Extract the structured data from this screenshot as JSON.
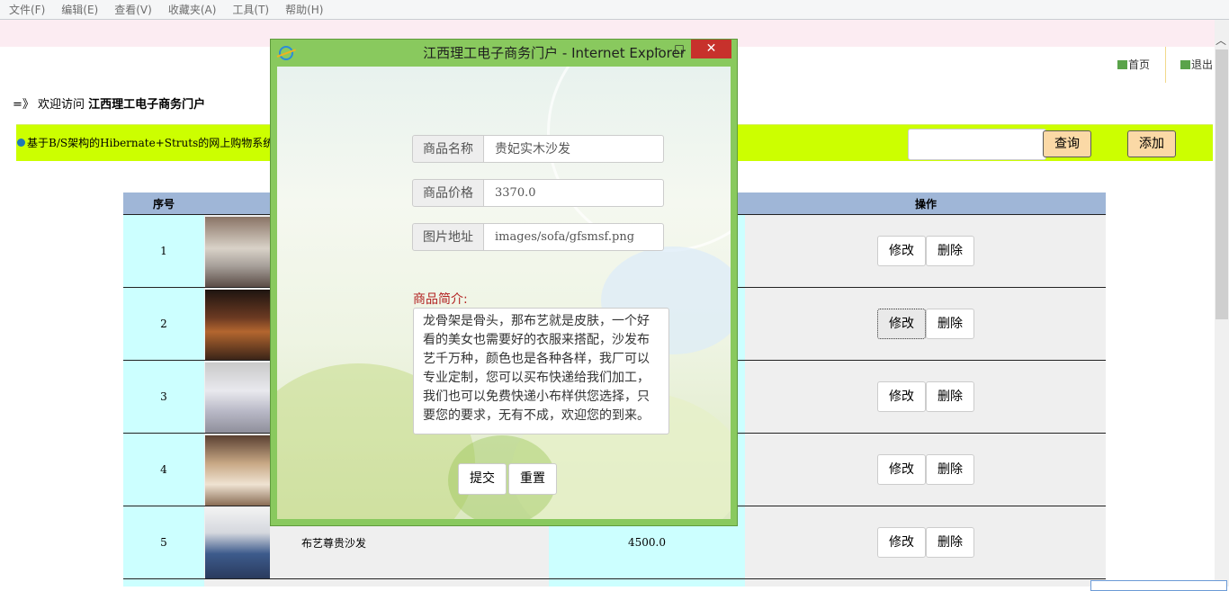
{
  "menu": [
    "文件(F)",
    "编辑(E)",
    "查看(V)",
    "收藏夹(A)",
    "工具(T)",
    "帮助(H)"
  ],
  "toplinks": {
    "home": "首页",
    "logout": "退出"
  },
  "welcome": {
    "prefix": "=》 欢迎访问 ",
    "site": "江西理工电子商务门户"
  },
  "banner_title": "基于B/S架构的Hibernate+Struts的网上购物系统的设",
  "toolbar": {
    "search_placeholder": "",
    "query_label": "查询",
    "add_label": "添加"
  },
  "table": {
    "headers": {
      "no": "序号",
      "action": "操作"
    },
    "rows": [
      {
        "no": "1",
        "name": "",
        "price": ""
      },
      {
        "no": "2",
        "name": "",
        "price": ""
      },
      {
        "no": "3",
        "name": "",
        "price": ""
      },
      {
        "no": "4",
        "name": "",
        "price": ""
      },
      {
        "no": "5",
        "name": "布艺尊贵沙发",
        "price": "4500.0"
      }
    ],
    "edit_label": "修改",
    "delete_label": "删除"
  },
  "popup": {
    "title": "江西理工电子商务门户 - Internet Explorer",
    "min": "‒",
    "max": "□",
    "close": "✕",
    "form": {
      "name_label": "商品名称",
      "name_value": "贵妃实木沙发",
      "price_label": "商品价格",
      "price_value": "3370.0",
      "image_label": "图片地址",
      "image_value": "images/sofa/gfsmsf.png",
      "desc_label": "商品简介:",
      "desc_value": "龙骨架是骨头，那布艺就是皮肤，一个好看的美女也需要好的衣服来搭配，沙发布艺千万种，颜色也是各种各样，我厂可以专业定制，您可以买布快递给我们加工，我们也可以免费快递小布样供您选择，只要您的要求，无有不成，欢迎您的到来。",
      "submit_label": "提交",
      "reset_label": "重置"
    }
  }
}
